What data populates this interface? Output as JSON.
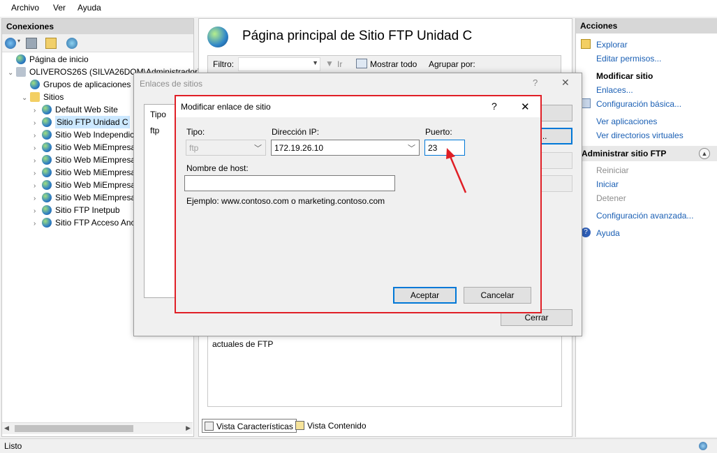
{
  "menu": [
    "Archivo",
    "Ver",
    "Ayuda"
  ],
  "connections": {
    "header": "Conexiones",
    "tree": [
      {
        "label": "Página de inicio",
        "level": 0
      },
      {
        "label": "OLIVEROS26S (SILVA26DOM\\Administrador)",
        "level": 0
      },
      {
        "label": "Grupos de aplicaciones",
        "level": 1
      },
      {
        "label": "Sitios",
        "level": 1
      },
      {
        "label": "Default Web Site",
        "level": 2
      },
      {
        "label": "Sitio FTP Unidad C",
        "level": 2,
        "selected": true
      },
      {
        "label": "Sitio Web Independic",
        "level": 2
      },
      {
        "label": "Sitio Web MiEmpresa",
        "level": 2
      },
      {
        "label": "Sitio Web MiEmpresa",
        "level": 2
      },
      {
        "label": "Sitio Web MiEmpresa",
        "level": 2
      },
      {
        "label": "Sitio Web MiEmpresa",
        "level": 2
      },
      {
        "label": "Sitio Web MiEmpresa",
        "level": 2
      },
      {
        "label": "Sitio FTP Inetpub",
        "level": 2
      },
      {
        "label": "Sitio FTP Acceso Anc",
        "level": 2
      }
    ]
  },
  "center": {
    "title": "Página principal de Sitio FTP Unidad C",
    "filter_label": "Filtro:",
    "go_label": "Ir",
    "show_all": "Mostrar todo",
    "group_by": "Agrupar por:",
    "content_text": "actuales de FTP",
    "views": [
      "Vista Características",
      "Vista Contenido"
    ]
  },
  "actions": {
    "header": "Acciones",
    "items1": [
      "Explorar",
      "Editar permisos..."
    ],
    "modify_header": "Modificar sitio",
    "items2": [
      "Enlaces...",
      "Configuración básica..."
    ],
    "items3": [
      "Ver aplicaciones",
      "Ver directorios virtuales"
    ],
    "manage_header": "Administrar sitio FTP",
    "manage_items": [
      {
        "label": "Reiniciar",
        "enabled": false
      },
      {
        "label": "Iniciar",
        "enabled": true
      },
      {
        "label": "Detener",
        "enabled": false
      }
    ],
    "advanced": "Configuración avanzada...",
    "help": "Ayuda"
  },
  "status": "Listo",
  "enlaces": {
    "title": "Enlaces de sitios",
    "help": "?",
    "close": "✕",
    "col_type": "Tipo",
    "row_type": "ftp",
    "btn_add": "...",
    "btn_edit": "...ar...",
    "close_label": "Cerrar"
  },
  "modificar": {
    "title": "Modificar enlace de sitio",
    "help": "?",
    "close": "✕",
    "type_label": "Tipo:",
    "type_value": "ftp",
    "ip_label": "Dirección IP:",
    "ip_value": "172.19.26.10",
    "port_label": "Puerto:",
    "port_value": "23",
    "host_label": "Nombre de host:",
    "host_value": "",
    "example": "Ejemplo: www.contoso.com o marketing.contoso.com",
    "ok": "Aceptar",
    "cancel": "Cancelar"
  },
  "colors": {
    "accent": "#0078d7",
    "highlight": "#e01f26",
    "link": "#1a5fb4"
  }
}
